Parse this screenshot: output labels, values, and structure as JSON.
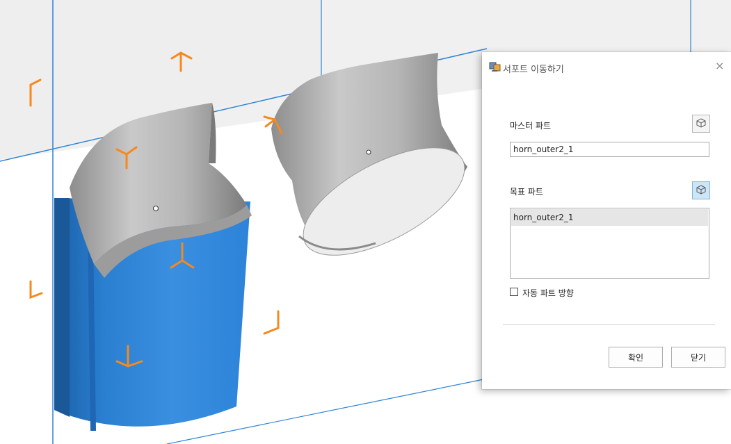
{
  "viewport": {
    "accent_blue": "#2f84d6",
    "gizmo_orange": "#f5891f",
    "part_gray": "#a8a8a8"
  },
  "dialog": {
    "title": "서포트 이동하기",
    "title_icon": "support-move-icon",
    "close_glyph": "×",
    "master_part_label": "마스터 파트",
    "master_part_value": "horn_outer2_1",
    "target_part_label": "목표 파트",
    "target_part_items": [
      "horn_outer2_1"
    ],
    "auto_direction_label": "자동 파트 방향",
    "auto_direction_checked": false,
    "confirm_label": "확인",
    "close_label": "닫기",
    "pick_icon": "cube-pick-icon"
  }
}
